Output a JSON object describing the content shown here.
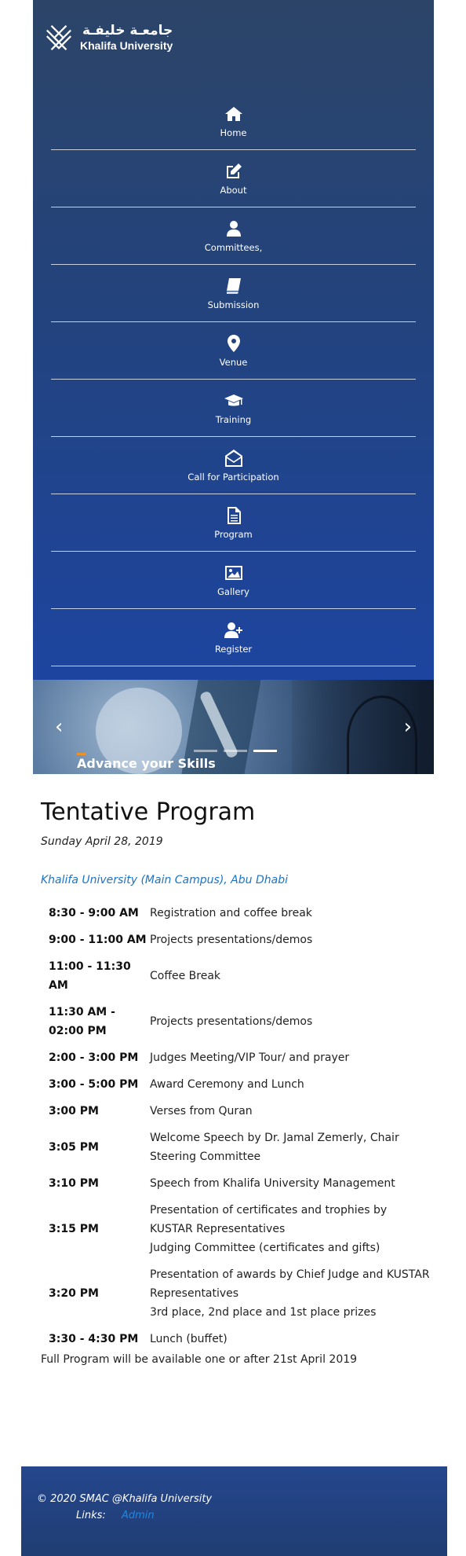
{
  "brand": {
    "name_ar": "جامعـة خليفـة",
    "name_en": "Khalifa University"
  },
  "nav": {
    "items": [
      {
        "label": "Home",
        "icon": "home-icon"
      },
      {
        "label": "About",
        "icon": "edit-icon"
      },
      {
        "label": "Committees,",
        "icon": "user-icon"
      },
      {
        "label": "Submission",
        "icon": "book-icon"
      },
      {
        "label": "Venue",
        "icon": "map-marker-icon"
      },
      {
        "label": "Training",
        "icon": "graduation-cap-icon"
      },
      {
        "label": "Call for Participation",
        "icon": "envelope-open-icon"
      },
      {
        "label": "Program",
        "icon": "document-icon"
      },
      {
        "label": "Gallery",
        "icon": "image-icon"
      },
      {
        "label": "Register",
        "icon": "user-plus-icon"
      }
    ]
  },
  "hero": {
    "caption": "Advance your Skills",
    "prev": "‹",
    "next": "›",
    "slide_count": 3,
    "active_slide": 3
  },
  "main": {
    "title": "Tentative Program",
    "date": "Sunday April 28, 2019",
    "location": "Khalifa University (Main Campus), Abu Dhabi",
    "program": [
      {
        "time": "8:30 - 9:00 AM",
        "desc": [
          "Registration and coffee break"
        ]
      },
      {
        "time": "9:00 - 11:00 AM",
        "desc": [
          "Projects presentations/demos"
        ]
      },
      {
        "time": "11:00 - 11:30 AM",
        "desc": [
          "Coffee Break"
        ]
      },
      {
        "time": "11:30 AM - 02:00 PM",
        "desc": [
          "Projects presentations/demos"
        ]
      },
      {
        "time": "2:00 - 3:00 PM",
        "desc": [
          "Judges Meeting/VIP Tour/ and prayer"
        ]
      },
      {
        "time": "3:00 - 5:00 PM",
        "desc": [
          "Award Ceremony and Lunch"
        ]
      },
      {
        "time": "3:00 PM",
        "desc": [
          "Verses from Quran"
        ]
      },
      {
        "time": "3:05 PM",
        "desc": [
          "Welcome Speech by Dr. Jamal Zemerly, Chair Steering Committee"
        ]
      },
      {
        "time": "3:10 PM",
        "desc": [
          "Speech from Khalifa University Management"
        ]
      },
      {
        "time": "3:15 PM",
        "desc": [
          "Presentation of certificates and trophies by KUSTAR Representatives",
          "Judging Committee (certificates and gifts)"
        ]
      },
      {
        "time": "3:20 PM",
        "desc": [
          "Presentation of awards by Chief Judge and KUSTAR Representatives",
          "3rd place, 2nd place and 1st place prizes"
        ]
      },
      {
        "time": "3:30 - 4:30 PM",
        "desc": [
          "Lunch (buffet)"
        ]
      }
    ],
    "note": "Full Program will be available one or after 21st April 2019"
  },
  "footer": {
    "copyright": "© 2020 SMAC @Khalifa University",
    "links_label": "Links:",
    "admin_link": "Admin"
  },
  "colors": {
    "nav_top": "#2c4468",
    "nav_bottom": "#1d45a0",
    "link": "#1a73c9",
    "footer": "#24468c",
    "accent": "#e8912f"
  }
}
